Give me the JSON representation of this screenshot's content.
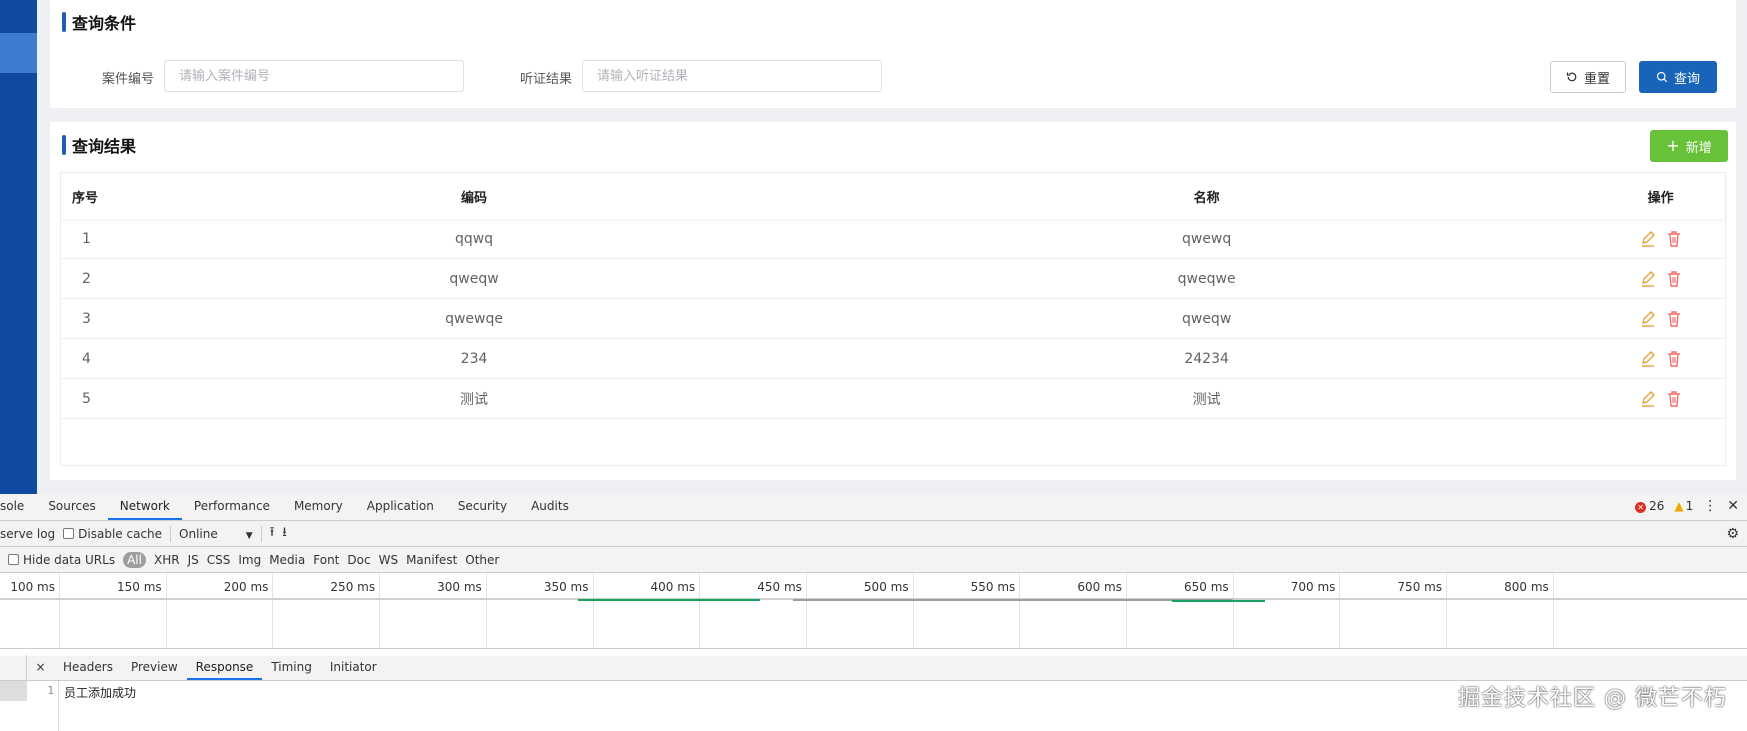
{
  "query": {
    "title": "查询条件",
    "fields": [
      {
        "label": "案件编号",
        "placeholder": "请输入案件编号",
        "value": ""
      },
      {
        "label": "听证结果",
        "placeholder": "请输入听证结果",
        "value": ""
      }
    ],
    "reset_label": "重置",
    "search_label": "查询"
  },
  "result": {
    "title": "查询结果",
    "add_label": "新增",
    "columns": [
      "序号",
      "编码",
      "名称",
      "操作"
    ],
    "rows": [
      {
        "idx": "1",
        "code": "qqwq",
        "name": "qwewq"
      },
      {
        "idx": "2",
        "code": "qweqw",
        "name": "qweqwe"
      },
      {
        "idx": "3",
        "code": "qwewqe",
        "name": "qweqw"
      },
      {
        "idx": "4",
        "code": "234",
        "name": "24234"
      },
      {
        "idx": "5",
        "code": "测试",
        "name": "测试"
      }
    ]
  },
  "devtools": {
    "tabs": [
      "sole",
      "Sources",
      "Network",
      "Performance",
      "Memory",
      "Application",
      "Security",
      "Audits"
    ],
    "active_tab": "Network",
    "errors": "26",
    "warnings": "1",
    "toolbar": {
      "preserve_log": "serve log",
      "disable_cache": "Disable cache",
      "throttle": "Online"
    },
    "filters": {
      "hide_data_urls": "Hide data URLs",
      "all": "All",
      "types": [
        "XHR",
        "JS",
        "CSS",
        "Img",
        "Media",
        "Font",
        "Doc",
        "WS",
        "Manifest",
        "Other"
      ]
    },
    "timeline_ticks": [
      "100 ms",
      "150 ms",
      "200 ms",
      "250 ms",
      "300 ms",
      "350 ms",
      "400 ms",
      "450 ms",
      "500 ms",
      "550 ms",
      "600 ms",
      "650 ms",
      "700 ms",
      "750 ms",
      "800 ms"
    ],
    "detail_tabs": [
      "Headers",
      "Preview",
      "Response",
      "Timing",
      "Initiator"
    ],
    "active_detail_tab": "Response",
    "close_symbol": "×",
    "response_line_no": "1",
    "response_text": "员工添加成功"
  },
  "watermark": "掘金技术社区 @ 微芒不朽",
  "colors": {
    "primary": "#1764b9",
    "success": "#67c23a",
    "sidebar": "#0f4aa0",
    "edit": "#e6a23c",
    "delete": "#f56c6c"
  }
}
